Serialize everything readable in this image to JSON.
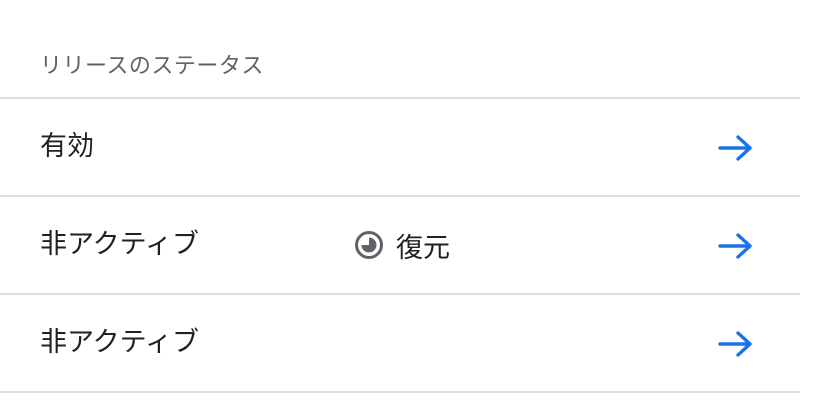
{
  "section": {
    "title": "リリースのステータス"
  },
  "rows": [
    {
      "label": "有効",
      "extra_label": "",
      "extra_icon": "",
      "arrow_icon": "arrow-right-icon"
    },
    {
      "label": "非アクティブ",
      "extra_label": "復元",
      "extra_icon": "restore-icon",
      "arrow_icon": "arrow-right-icon"
    },
    {
      "label": "非アクティブ",
      "extra_label": "",
      "extra_icon": "",
      "arrow_icon": "arrow-right-icon"
    }
  ],
  "colors": {
    "accent": "#1a73e8",
    "divider": "#dadce0",
    "header_text": "#5f6368",
    "body_text": "#202124",
    "icon": "#5f6368"
  }
}
